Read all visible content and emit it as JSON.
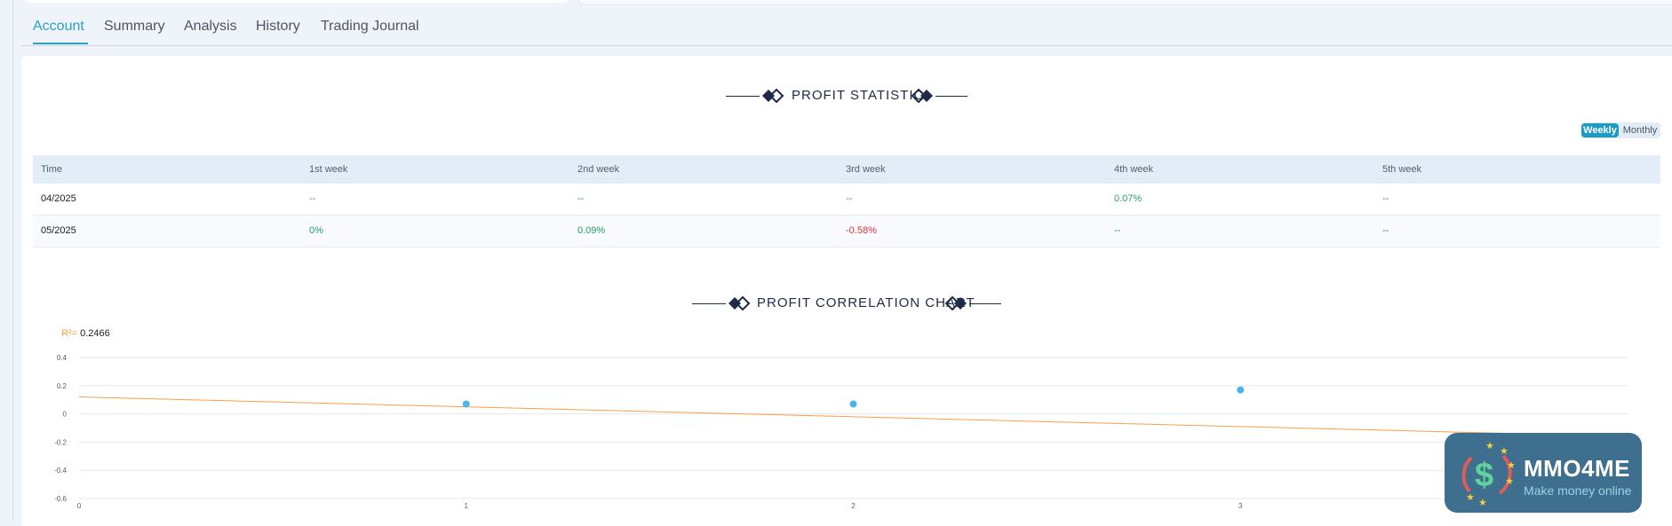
{
  "tabs": [
    {
      "label": "Account",
      "active": true
    },
    {
      "label": "Summary",
      "active": false
    },
    {
      "label": "Analysis",
      "active": false
    },
    {
      "label": "History",
      "active": false
    },
    {
      "label": "Trading Journal",
      "active": false
    }
  ],
  "profit_statistic": {
    "title": "PROFIT STATISTIC",
    "toggle": {
      "options": [
        "Weekly",
        "Monthly"
      ],
      "selected": "Weekly"
    },
    "columns": [
      "Time",
      "1st week",
      "2nd week",
      "3rd week",
      "4th week",
      "5th week"
    ],
    "rows": [
      {
        "time": "04/2025",
        "cells": [
          "--",
          "--",
          "--",
          "0.07%",
          "--"
        ]
      },
      {
        "time": "05/2025",
        "cells": [
          "0%",
          "0.09%",
          "-0.58%",
          "--",
          "--"
        ]
      }
    ]
  },
  "correlation": {
    "title": "PROFIT CORRELATION CHART",
    "r2_label": "R²=",
    "r2_value": "0.2466"
  },
  "chart_data": {
    "type": "scatter",
    "title": "PROFIT CORRELATION CHART",
    "x_ticks": [
      "0",
      "1",
      "2",
      "3"
    ],
    "y_ticks": [
      "0.4",
      "0.2",
      "0",
      "-0.2",
      "-0.4",
      "-0.6"
    ],
    "xlim": [
      0,
      4
    ],
    "ylim": [
      -0.6,
      0.4
    ],
    "points": [
      {
        "x": 1,
        "y": 0.07
      },
      {
        "x": 2,
        "y": 0.07
      },
      {
        "x": 3,
        "y": 0.17
      }
    ],
    "trendline": {
      "x": [
        0,
        4
      ],
      "y": [
        0.12,
        -0.16
      ]
    },
    "r_squared": 0.2466,
    "grid": true,
    "colors": {
      "points": "#4ab3f0",
      "trendline": "#f5a04a",
      "grid": "#e3e7ee",
      "ticks": "#555d6b"
    }
  },
  "logo": {
    "name": "MMO4ME",
    "tagline": "Make money online"
  },
  "colors": {
    "accent": "#2b9fc4",
    "positive": "#22a363",
    "negative": "#e0323c",
    "title": "#1e2a4a"
  }
}
